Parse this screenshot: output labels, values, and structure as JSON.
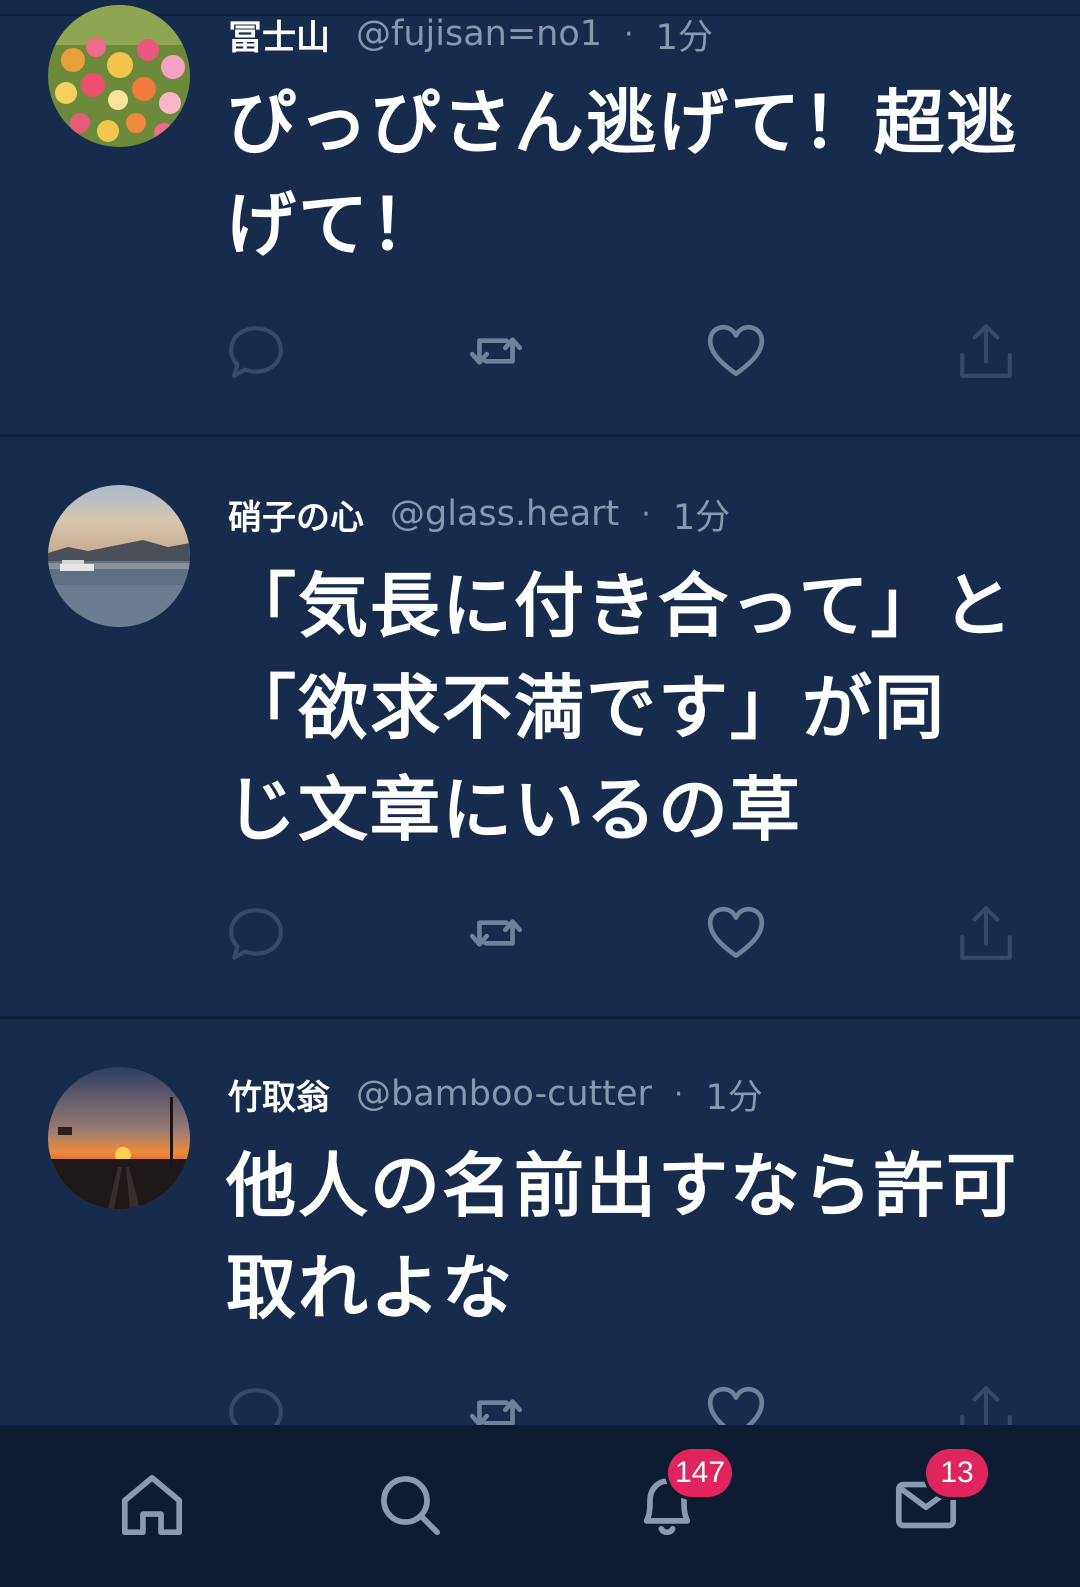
{
  "tweets": [
    {
      "name": "冨士山",
      "handle": "@fujisan=no1",
      "separator": "·",
      "time": "1分",
      "text": "ぴっぴさん逃げて！超逃げて！"
    },
    {
      "name": "硝子の心",
      "handle": "@glass.heart",
      "separator": "·",
      "time": "1分",
      "text": "「気長に付き合って」と「欲求不満です」が同じ文章にいるの草"
    },
    {
      "name": "竹取翁",
      "handle": "@bamboo-cutter",
      "separator": "·",
      "time": "1分",
      "text": "他人の名前出すなら許可取れよな"
    }
  ],
  "tabbar": {
    "notifications_badge": "147",
    "messages_badge": "13"
  },
  "colors": {
    "background": "#172b4d",
    "tabbar": "#0e1c31",
    "muted": "#8899ac",
    "icon": "#6f8299",
    "badge": "#e0245e"
  },
  "icons": {
    "actions": [
      "reply-icon",
      "retweet-icon",
      "like-icon",
      "share-icon"
    ],
    "tabs": [
      "home-icon",
      "search-icon",
      "bell-icon",
      "mail-icon"
    ]
  }
}
